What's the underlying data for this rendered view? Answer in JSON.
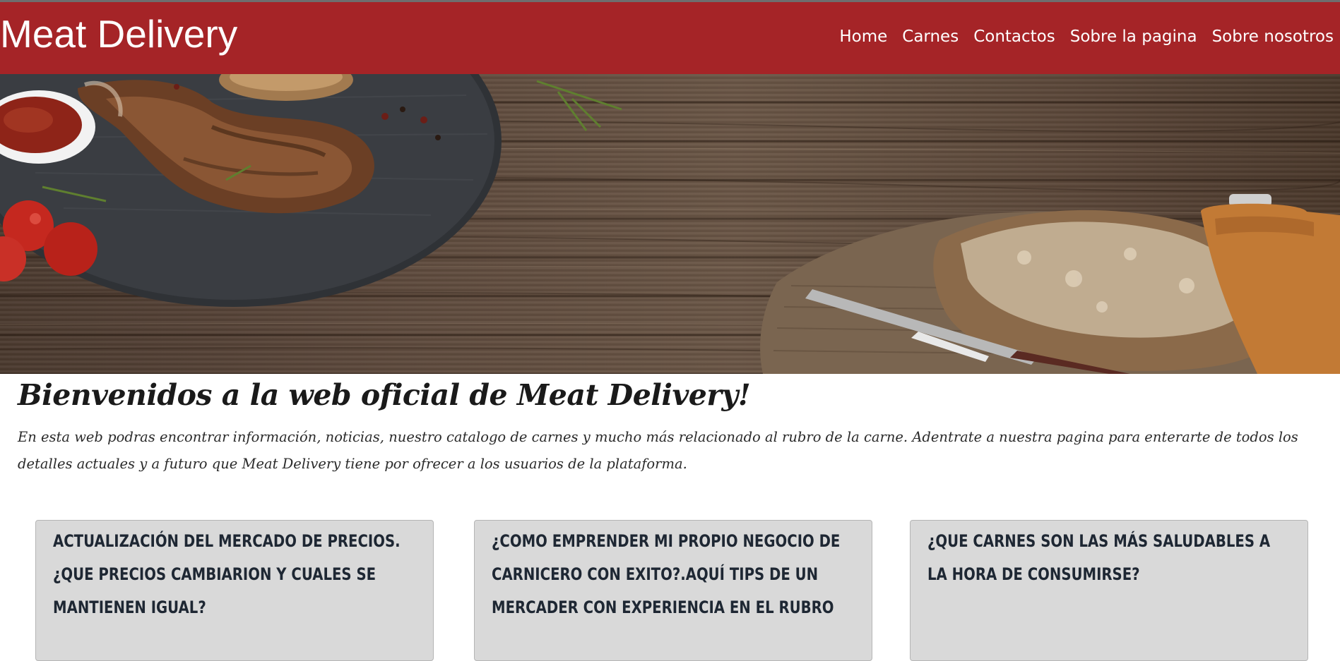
{
  "header": {
    "brand": "Meat Delivery",
    "nav": [
      "Home",
      "Carnes",
      "Contactos",
      "Sobre la pagina",
      "Sobre nosotros"
    ],
    "background_color": "#a52427"
  },
  "hero": {
    "image_description_icon": "meat-board-hero-image"
  },
  "main": {
    "welcome_title": "Bienvenidos a la web oficial de Meat Delivery!",
    "intro_text": "En esta web podras encontrar información, noticias, nuestro catalogo de carnes y mucho más relacionado al rubro de la carne. Adentrate a nuestra pagina para enterarte de todos los detalles actuales y a futuro que Meat Delivery tiene por ofrecer a los usuarios de la plataforma."
  },
  "cards": [
    {
      "title": "Actualización del mercado de precios.¿Que precios cambiarion y cuales se mantienen igual?"
    },
    {
      "title": "¿Como emprender mi propio negocio de carnicero con exito?.Aquí tips de un mercader con experiencia en el rubro"
    },
    {
      "title": "¿Que carnes son las más saludables a la hora de consumirse?"
    }
  ]
}
